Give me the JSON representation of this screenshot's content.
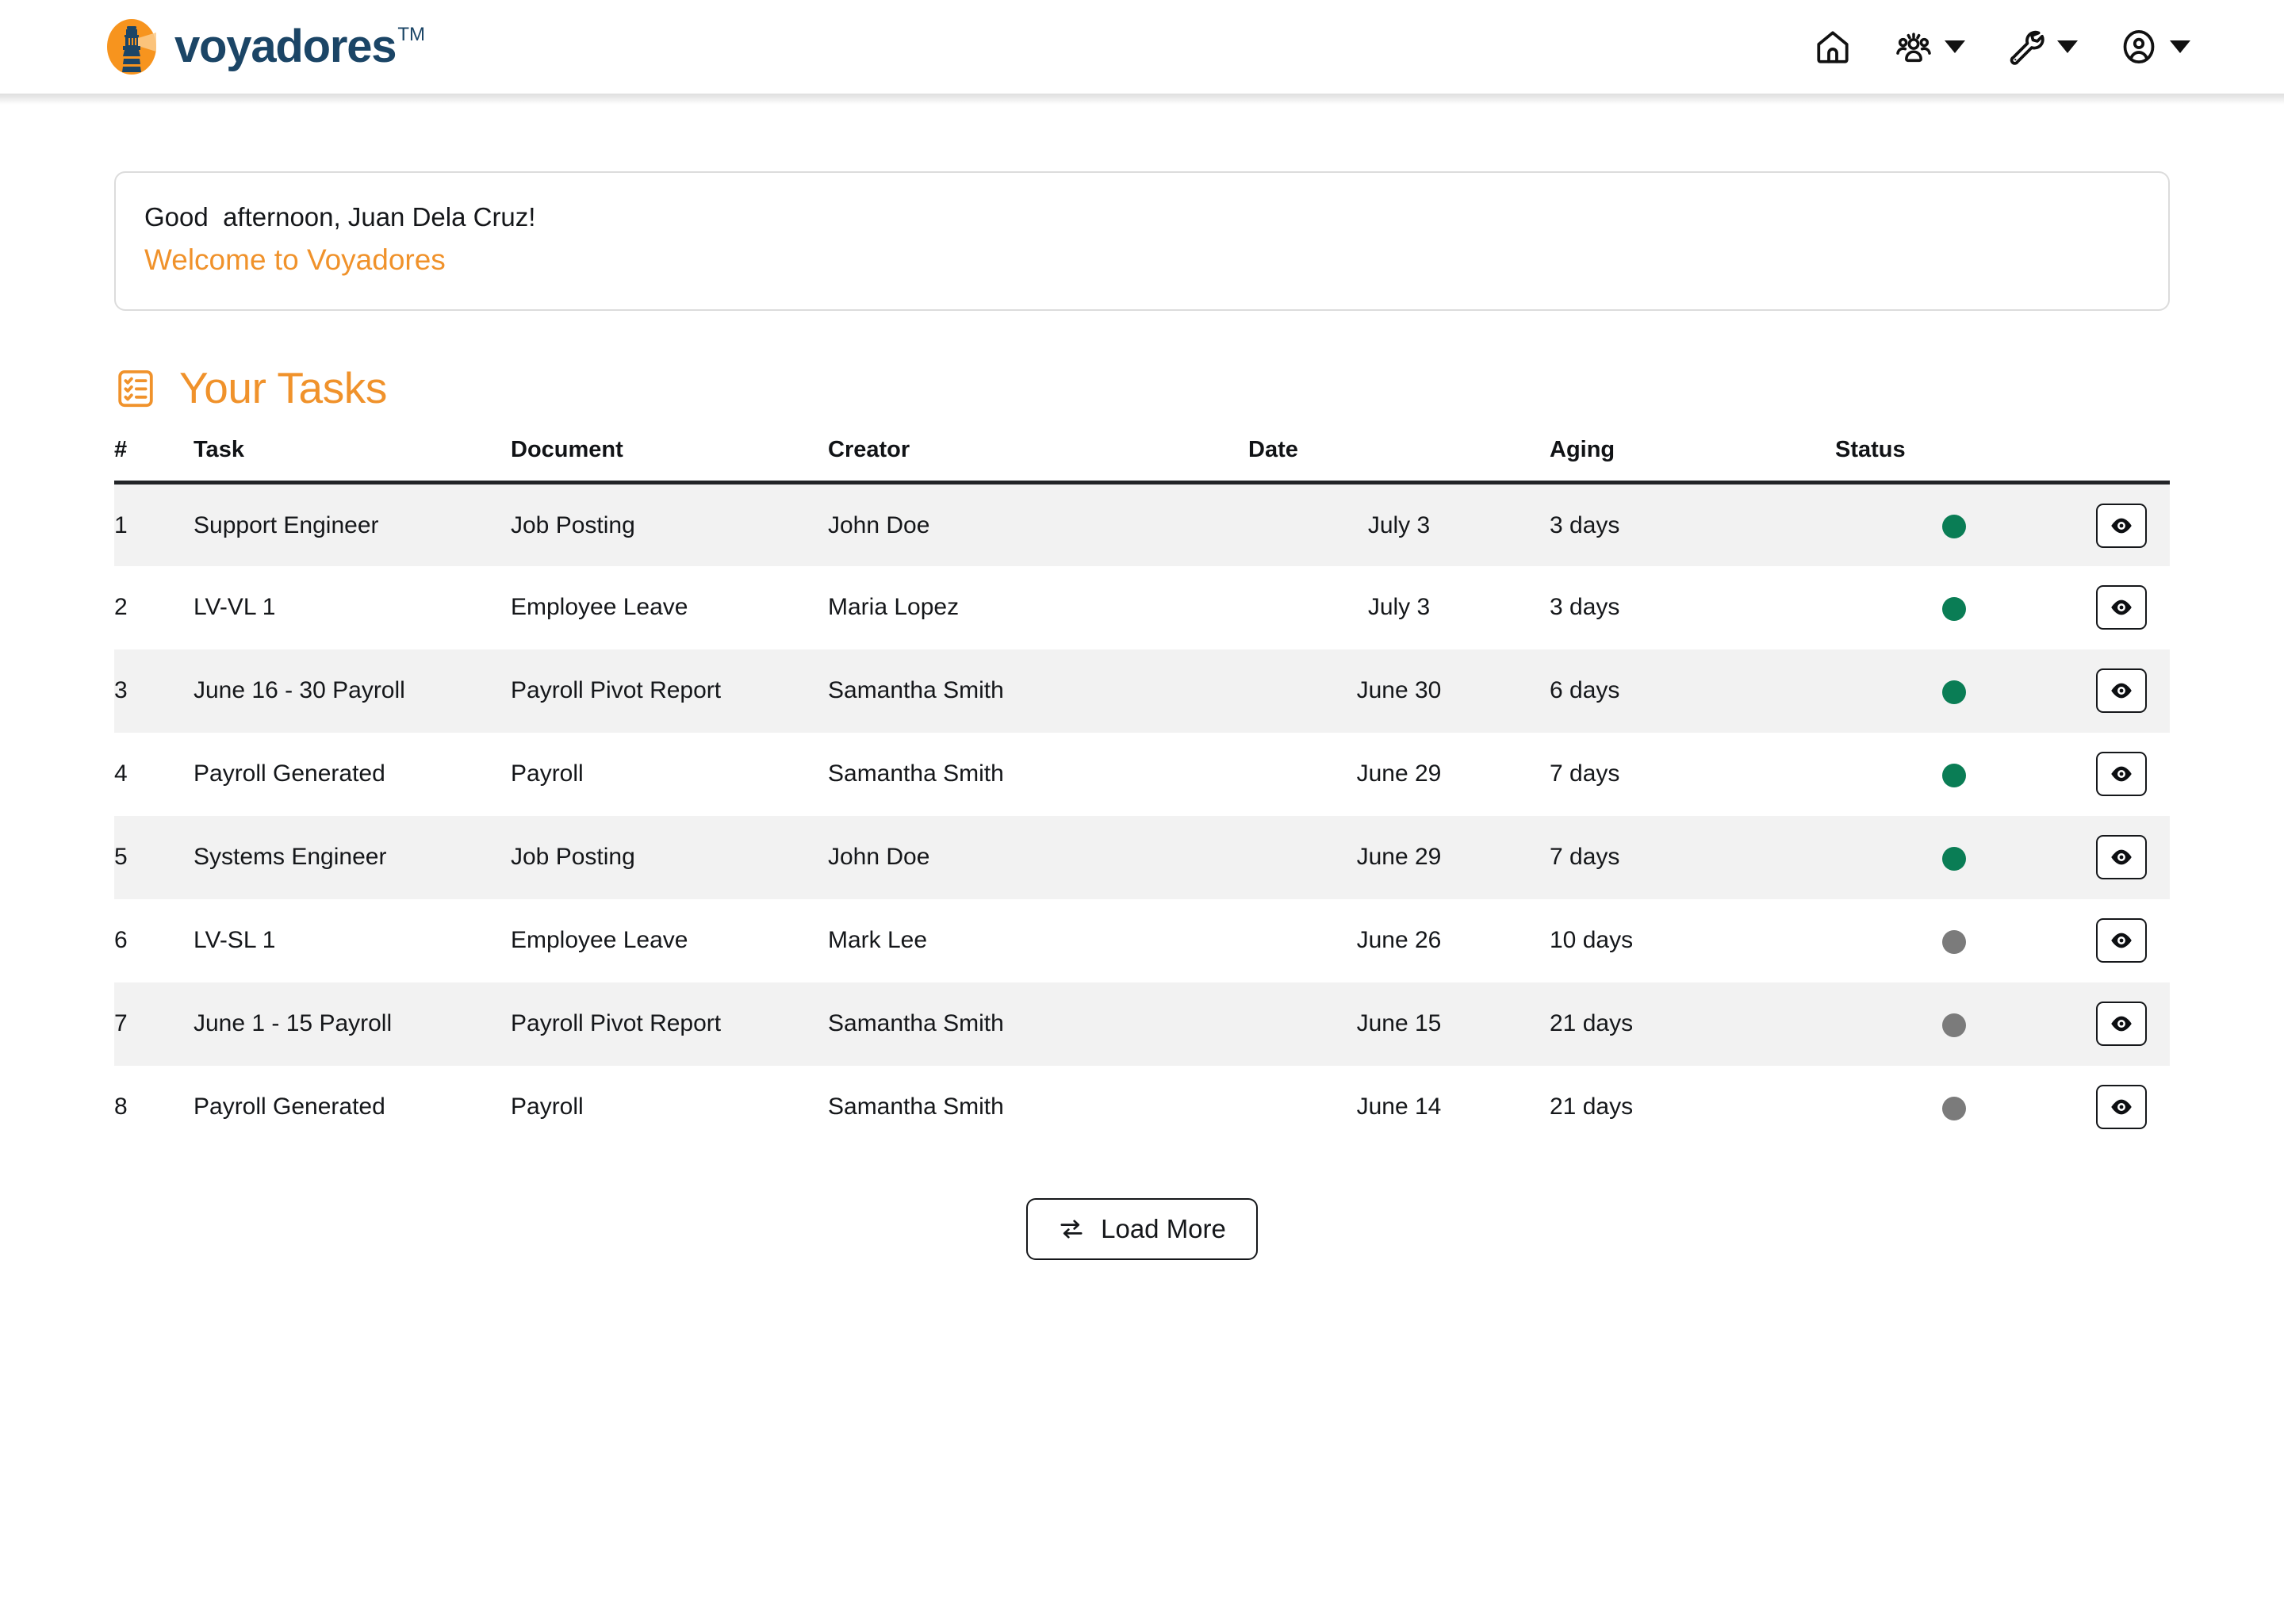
{
  "brand": {
    "name": "voyadores",
    "trademark": "TM",
    "logo_icon": "lighthouse-icon",
    "logo_bg_color": "#F7941E",
    "wordmark_color": "#1B4566"
  },
  "nav": {
    "items": [
      {
        "icon": "home-icon",
        "label": "Home",
        "has_caret": false
      },
      {
        "icon": "people-group-icon",
        "label": "People",
        "has_caret": true
      },
      {
        "icon": "wrench-icon",
        "label": "Tools",
        "has_caret": true
      },
      {
        "icon": "account-circle-icon",
        "label": "Account",
        "has_caret": true
      }
    ]
  },
  "welcome": {
    "greeting": "Good  afternoon, Juan Dela Cruz!",
    "subtitle": "Welcome to Voyadores"
  },
  "tasks_section": {
    "icon": "checklist-icon",
    "title": "Your Tasks",
    "accent_color": "#F0922B"
  },
  "table": {
    "columns": [
      "#",
      "Task",
      "Document",
      "Creator",
      "Date",
      "Aging",
      "Status",
      ""
    ],
    "rows": [
      {
        "num": "1",
        "task": "Support Engineer",
        "document": "Job Posting",
        "creator": "John Doe",
        "date": "July 3",
        "aging": "3 days",
        "status": "green",
        "action_icon": "eye-icon"
      },
      {
        "num": "2",
        "task": "LV-VL 1",
        "document": "Employee Leave",
        "creator": "Maria Lopez",
        "date": "July 3",
        "aging": "3 days",
        "status": "green",
        "action_icon": "eye-icon"
      },
      {
        "num": "3",
        "task": "June 16 - 30 Payroll",
        "document": "Payroll Pivot Report",
        "creator": "Samantha Smith",
        "date": "June 30",
        "aging": "6 days",
        "status": "green",
        "action_icon": "eye-icon"
      },
      {
        "num": "4",
        "task": "Payroll Generated",
        "document": "Payroll",
        "creator": "Samantha Smith",
        "date": "June 29",
        "aging": "7 days",
        "status": "green",
        "action_icon": "eye-icon"
      },
      {
        "num": "5",
        "task": "Systems Engineer",
        "document": "Job Posting",
        "creator": "John Doe",
        "date": "June 29",
        "aging": "7 days",
        "status": "green",
        "action_icon": "eye-icon"
      },
      {
        "num": "6",
        "task": "LV-SL 1",
        "document": "Employee Leave",
        "creator": "Mark Lee",
        "date": "June 26",
        "aging": "10 days",
        "status": "grey",
        "action_icon": "eye-icon"
      },
      {
        "num": "7",
        "task": "June 1 - 15 Payroll",
        "document": "Payroll Pivot Report",
        "creator": "Samantha Smith",
        "date": "June 15",
        "aging": "21 days",
        "status": "grey",
        "action_icon": "eye-icon"
      },
      {
        "num": "8",
        "task": "Payroll Generated",
        "document": "Payroll",
        "creator": "Samantha Smith",
        "date": "June 14",
        "aging": "21 days",
        "status": "grey",
        "action_icon": "eye-icon"
      }
    ],
    "status_colors": {
      "green": "#0A7D55",
      "grey": "#7B7B7B"
    }
  },
  "load_more": {
    "label": "Load More",
    "icon": "loop-arrows-icon"
  }
}
